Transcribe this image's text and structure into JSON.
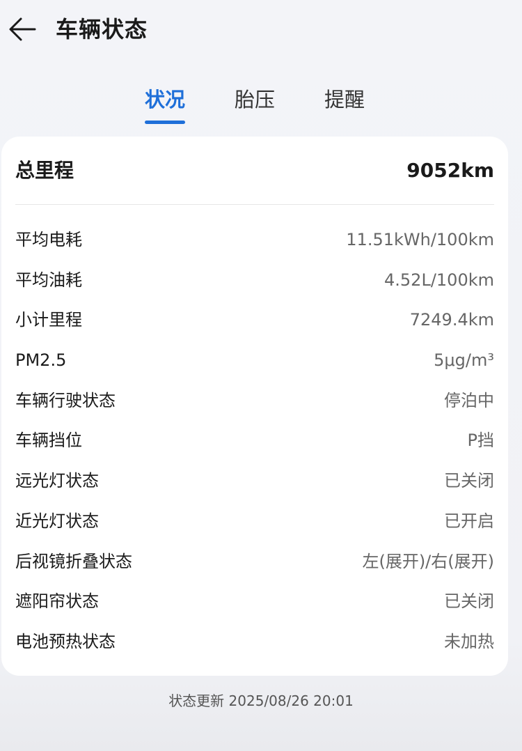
{
  "header": {
    "back_icon": "arrow-left-icon",
    "title": "车辆状态"
  },
  "tabs": [
    {
      "label": "状况",
      "active": true
    },
    {
      "label": "胎压",
      "active": false
    },
    {
      "label": "提醒",
      "active": false
    }
  ],
  "summary": {
    "label": "总里程",
    "value": "9052km"
  },
  "rows": [
    {
      "label": "平均电耗",
      "value": "11.51kWh/100km"
    },
    {
      "label": "平均油耗",
      "value": "4.52L/100km"
    },
    {
      "label": "小计里程",
      "value": "7249.4km"
    },
    {
      "label": "PM2.5",
      "value": "5μg/m³"
    },
    {
      "label": "车辆行驶状态",
      "value": "停泊中"
    },
    {
      "label": "车辆挡位",
      "value": "P挡"
    },
    {
      "label": "远光灯状态",
      "value": "已关闭"
    },
    {
      "label": "近光灯状态",
      "value": "已开启"
    },
    {
      "label": "后视镜折叠状态",
      "value": "左(展开)/右(展开)"
    },
    {
      "label": "遮阳帘状态",
      "value": "已关闭"
    },
    {
      "label": "电池预热状态",
      "value": "未加热"
    }
  ],
  "footer": {
    "status_update": "状态更新 2025/08/26 20:01"
  },
  "colors": {
    "accent": "#1e6fd9",
    "background": "#f3f4f8",
    "card": "#ffffff"
  }
}
